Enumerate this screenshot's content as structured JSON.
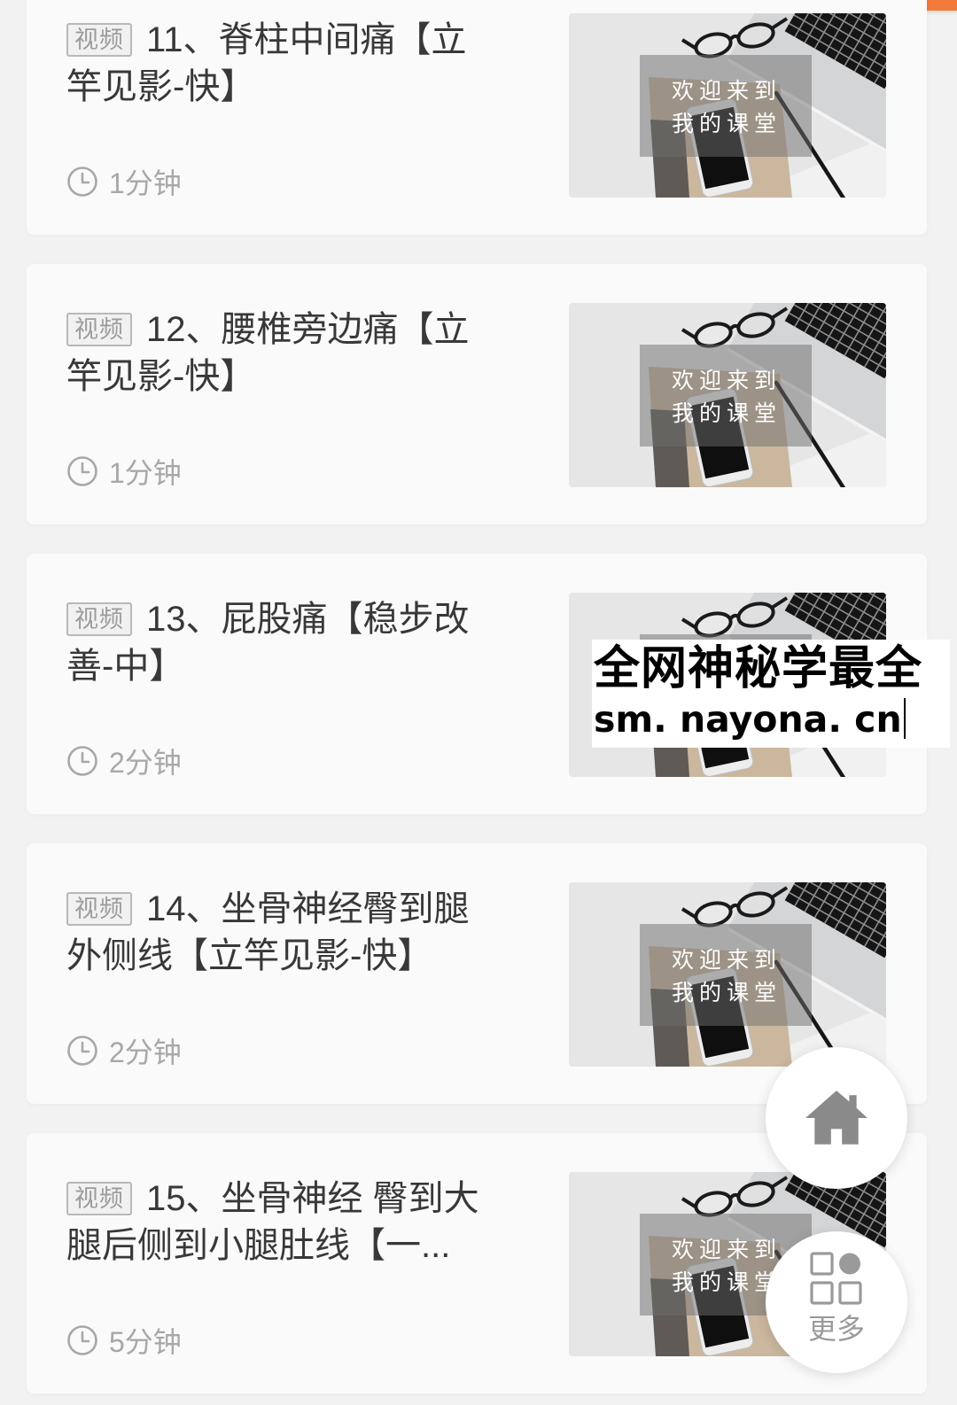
{
  "top_bar": {
    "action_button_color": "#f27a3b"
  },
  "lessons": [
    {
      "badge": "视频",
      "title_line1": "11、脊柱中间痛【立",
      "title_line2": "竿见影-快】",
      "duration": "1分钟"
    },
    {
      "badge": "视频",
      "title_line1": "12、腰椎旁边痛【立",
      "title_line2": "竿见影-快】",
      "duration": "1分钟"
    },
    {
      "badge": "视频",
      "title_line1": "13、屁股痛【稳步改",
      "title_line2": "善-中】",
      "duration": "2分钟"
    },
    {
      "badge": "视频",
      "title_line1": "14、坐骨神经臀到腿",
      "title_line2": "外侧线【立竿见影-快】",
      "duration": "2分钟"
    },
    {
      "badge": "视频",
      "title_line1": "15、坐骨神经 臀到大",
      "title_line2": "腿后侧到小腿肚线【一...",
      "duration": "5分钟"
    }
  ],
  "cover": {
    "line1": "欢迎来到",
    "line2": "我的课堂"
  },
  "watermark": {
    "line1": "全网神秘学最全",
    "line2": "sm. nayona. cn"
  },
  "floating_buttons": {
    "home": {
      "icon": "home-icon"
    },
    "more": {
      "icon": "grid-icon",
      "label": "更多"
    }
  },
  "icons": {
    "duration": "clock-icon"
  },
  "colors": {
    "accent": "#f27a3b",
    "title_text": "#383838",
    "meta_text": "#a8a8a8",
    "page_background": "#f2f2f2",
    "card_background": "#fafafa"
  }
}
